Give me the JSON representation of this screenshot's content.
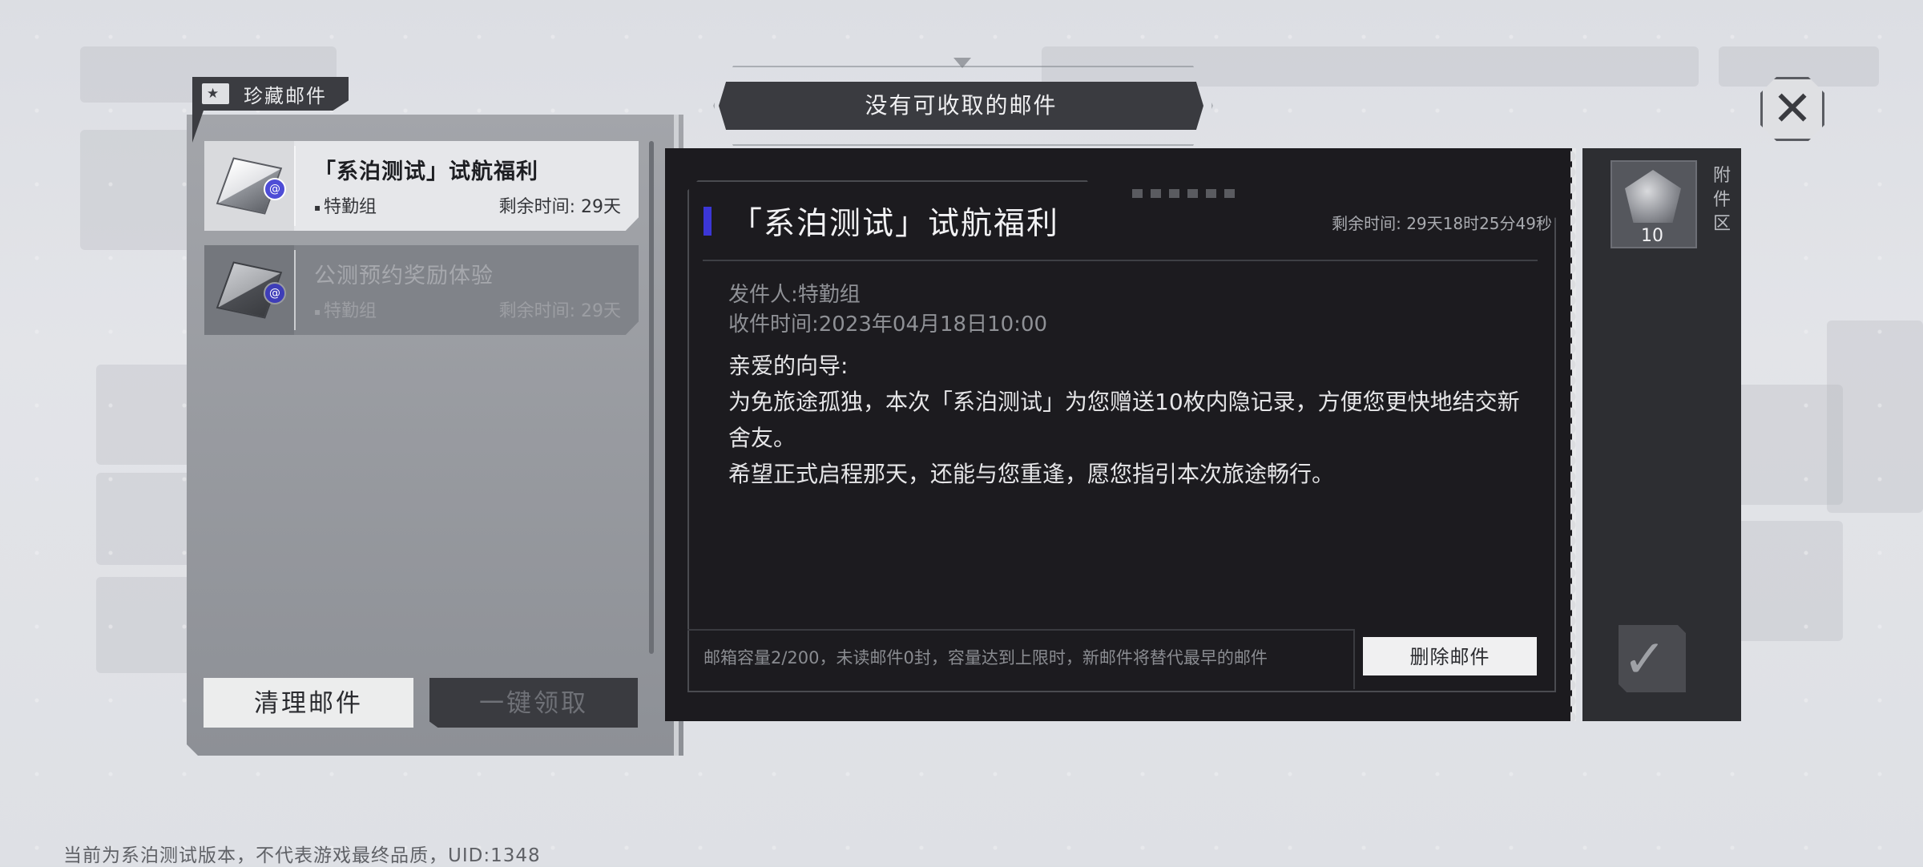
{
  "header": {
    "banner_text": "没有可收取的邮件",
    "close_icon": "close-icon"
  },
  "sidebar": {
    "tab_label": "珍藏邮件",
    "tab_icon": "star-mail-icon",
    "mails": [
      {
        "title": "「系泊测试」试航福利",
        "sender": "特勤组",
        "remaining": "剩余时间: 29天",
        "badge": "@",
        "state": "selected"
      },
      {
        "title": "公测预约奖励体验",
        "sender": "特勤组",
        "remaining": "剩余时间: 29天",
        "badge": "@",
        "state": "unselected"
      }
    ],
    "clean_button": "清理邮件",
    "claim_all_button": "一键领取"
  },
  "mail": {
    "title": "「系泊测试」试航福利",
    "remaining_time": "剩余时间: 29天18时25分49秒",
    "sender": "发件人:特勤组",
    "received": "收件时间:2023年04月18日10:00",
    "body": [
      "亲爱的向导:",
      "为免旅途孤独，本次「系泊测试」为您赠送10枚内隐记录，方便您更快地结交新舍友。",
      "希望正式启程那天，还能与您重逢，愿您指引本次旅途畅行。"
    ],
    "capacity": "邮箱容量2/200，未读邮件0封，容量达到上限时，新邮件将替代最早的邮件",
    "delete_button": "删除邮件"
  },
  "attachments": {
    "label": "附件区",
    "items": [
      {
        "count": "10",
        "icon": "memory-shard-icon"
      }
    ],
    "check_icon": "checkmark-icon"
  },
  "footer": {
    "version_notice": "当前为系泊测试版本，不代表游戏最终品质，UID:1348"
  },
  "colors": {
    "accent": "#3b36d6",
    "panel_dark": "#1c1b1f",
    "panel_gray": "#8d9096"
  }
}
